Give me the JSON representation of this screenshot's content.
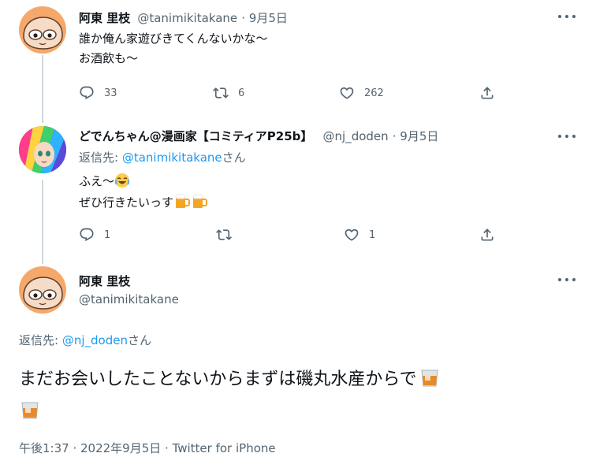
{
  "tweets": [
    {
      "display_name": "阿東 里枝",
      "handle": "@tanimikitakane",
      "date": "9月5日",
      "lines": [
        "誰か俺ん家遊びきてくんないかな〜",
        "お酒飲も〜"
      ],
      "reply_count": "33",
      "retweet_count": "6",
      "like_count": "262"
    },
    {
      "display_name": "どでんちゃん@漫画家【コミティアP25b】",
      "handle": "@nj_doden",
      "date": "9月5日",
      "reply_prefix": "返信先: ",
      "reply_to": "@tanimikitakane",
      "reply_suffix": "さん",
      "line1": "ふえ〜",
      "line2": "ぜひ行きたいっす",
      "reply_count": "1",
      "retweet_count": "",
      "like_count": "1"
    }
  ],
  "main_tweet": {
    "display_name": "阿東 里枝",
    "handle": "@tanimikitakane",
    "reply_prefix": "返信先: ",
    "reply_to": "@nj_doden",
    "reply_suffix": "さん",
    "text": "まだお会いしたことないからまずは磯丸水産からで",
    "timestamp": "午後1:37 · 2022年9月5日 · Twitter for iPhone"
  },
  "colors": {
    "link": "#1d9bf0",
    "secondary_text": "#536471",
    "thread_line": "#cfd9de"
  },
  "icons": [
    "reply-icon",
    "retweet-icon",
    "like-icon",
    "share-icon",
    "more-icon",
    "laughing-emoji",
    "beer-emoji",
    "whisky-emoji"
  ]
}
